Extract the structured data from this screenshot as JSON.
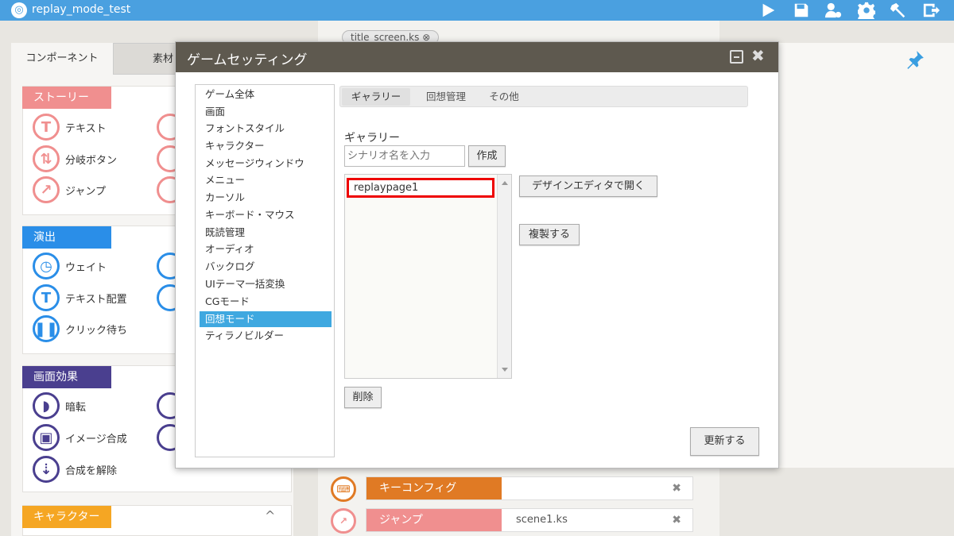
{
  "app": {
    "title": "replay_mode_test"
  },
  "toolbar": {
    "icons": [
      "play-icon",
      "save-icon",
      "user-settings-icon",
      "gear-icon",
      "build-icon",
      "export-icon"
    ]
  },
  "left_panel": {
    "tabs": [
      "コンポーネント",
      "素材"
    ],
    "categories": [
      {
        "label": "ストーリー",
        "color": "#f08f8f",
        "items": [
          "テキスト",
          "分岐ボタン",
          "ジャンプ"
        ]
      },
      {
        "label": "演出",
        "color": "#2a8ee8",
        "items": [
          "ウェイト",
          "テキスト配置",
          "クリック待ち"
        ]
      },
      {
        "label": "画面効果",
        "color": "#4a3f8f",
        "items": [
          "暗転",
          "イメージ合成",
          "合成を解除"
        ]
      },
      {
        "label": "キャラクター",
        "color": "#f5a623",
        "items": []
      }
    ],
    "collapse_symbol": "^"
  },
  "editor": {
    "tab": {
      "label": "title_screen.ks",
      "close": "⊗"
    },
    "rows": [
      {
        "label": "キーコンフィグ",
        "param": "",
        "color": "#e07a24"
      },
      {
        "label": "ジャンプ",
        "param": "scene1.ks",
        "color": "#f08f8f"
      }
    ],
    "close_symbol": "✖"
  },
  "dialog": {
    "title": "ゲームセッティング",
    "close_symbol": "✖",
    "menu": [
      "ゲーム全体",
      "画面",
      "フォントスタイル",
      "キャラクター",
      "メッセージウィンドウ",
      "メニュー",
      "カーソル",
      "キーボード・マウス",
      "既読管理",
      "オーディオ",
      "バックログ",
      "UIテーマ一括変換",
      "CGモード",
      "回想モード",
      "ティラノビルダー"
    ],
    "menu_selected": "回想モード",
    "tabs": [
      "ギャラリー",
      "回想管理",
      "その他"
    ],
    "active_tab": "ギャラリー",
    "section_label": "ギャラリー",
    "scenario_input": {
      "placeholder": "シナリオ名を入力",
      "value": ""
    },
    "create_button": "作成",
    "list_items": [
      "replaypage1"
    ],
    "open_editor_button": "デザインエディタで開く",
    "duplicate_button": "複製する",
    "delete_button": "削除",
    "update_button": "更新する"
  }
}
